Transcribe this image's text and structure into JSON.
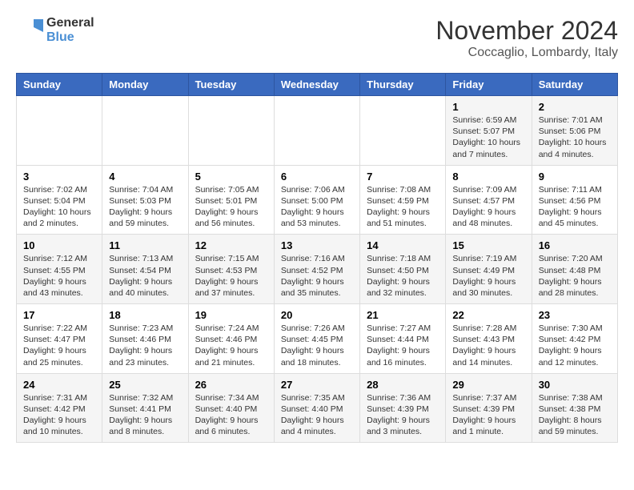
{
  "logo": {
    "line1": "General",
    "line2": "Blue"
  },
  "title": "November 2024",
  "location": "Coccaglio, Lombardy, Italy",
  "weekdays": [
    "Sunday",
    "Monday",
    "Tuesday",
    "Wednesday",
    "Thursday",
    "Friday",
    "Saturday"
  ],
  "weeks": [
    [
      {
        "day": "",
        "info": ""
      },
      {
        "day": "",
        "info": ""
      },
      {
        "day": "",
        "info": ""
      },
      {
        "day": "",
        "info": ""
      },
      {
        "day": "",
        "info": ""
      },
      {
        "day": "1",
        "info": "Sunrise: 6:59 AM\nSunset: 5:07 PM\nDaylight: 10 hours and 7 minutes."
      },
      {
        "day": "2",
        "info": "Sunrise: 7:01 AM\nSunset: 5:06 PM\nDaylight: 10 hours and 4 minutes."
      }
    ],
    [
      {
        "day": "3",
        "info": "Sunrise: 7:02 AM\nSunset: 5:04 PM\nDaylight: 10 hours and 2 minutes."
      },
      {
        "day": "4",
        "info": "Sunrise: 7:04 AM\nSunset: 5:03 PM\nDaylight: 9 hours and 59 minutes."
      },
      {
        "day": "5",
        "info": "Sunrise: 7:05 AM\nSunset: 5:01 PM\nDaylight: 9 hours and 56 minutes."
      },
      {
        "day": "6",
        "info": "Sunrise: 7:06 AM\nSunset: 5:00 PM\nDaylight: 9 hours and 53 minutes."
      },
      {
        "day": "7",
        "info": "Sunrise: 7:08 AM\nSunset: 4:59 PM\nDaylight: 9 hours and 51 minutes."
      },
      {
        "day": "8",
        "info": "Sunrise: 7:09 AM\nSunset: 4:57 PM\nDaylight: 9 hours and 48 minutes."
      },
      {
        "day": "9",
        "info": "Sunrise: 7:11 AM\nSunset: 4:56 PM\nDaylight: 9 hours and 45 minutes."
      }
    ],
    [
      {
        "day": "10",
        "info": "Sunrise: 7:12 AM\nSunset: 4:55 PM\nDaylight: 9 hours and 43 minutes."
      },
      {
        "day": "11",
        "info": "Sunrise: 7:13 AM\nSunset: 4:54 PM\nDaylight: 9 hours and 40 minutes."
      },
      {
        "day": "12",
        "info": "Sunrise: 7:15 AM\nSunset: 4:53 PM\nDaylight: 9 hours and 37 minutes."
      },
      {
        "day": "13",
        "info": "Sunrise: 7:16 AM\nSunset: 4:52 PM\nDaylight: 9 hours and 35 minutes."
      },
      {
        "day": "14",
        "info": "Sunrise: 7:18 AM\nSunset: 4:50 PM\nDaylight: 9 hours and 32 minutes."
      },
      {
        "day": "15",
        "info": "Sunrise: 7:19 AM\nSunset: 4:49 PM\nDaylight: 9 hours and 30 minutes."
      },
      {
        "day": "16",
        "info": "Sunrise: 7:20 AM\nSunset: 4:48 PM\nDaylight: 9 hours and 28 minutes."
      }
    ],
    [
      {
        "day": "17",
        "info": "Sunrise: 7:22 AM\nSunset: 4:47 PM\nDaylight: 9 hours and 25 minutes."
      },
      {
        "day": "18",
        "info": "Sunrise: 7:23 AM\nSunset: 4:46 PM\nDaylight: 9 hours and 23 minutes."
      },
      {
        "day": "19",
        "info": "Sunrise: 7:24 AM\nSunset: 4:46 PM\nDaylight: 9 hours and 21 minutes."
      },
      {
        "day": "20",
        "info": "Sunrise: 7:26 AM\nSunset: 4:45 PM\nDaylight: 9 hours and 18 minutes."
      },
      {
        "day": "21",
        "info": "Sunrise: 7:27 AM\nSunset: 4:44 PM\nDaylight: 9 hours and 16 minutes."
      },
      {
        "day": "22",
        "info": "Sunrise: 7:28 AM\nSunset: 4:43 PM\nDaylight: 9 hours and 14 minutes."
      },
      {
        "day": "23",
        "info": "Sunrise: 7:30 AM\nSunset: 4:42 PM\nDaylight: 9 hours and 12 minutes."
      }
    ],
    [
      {
        "day": "24",
        "info": "Sunrise: 7:31 AM\nSunset: 4:42 PM\nDaylight: 9 hours and 10 minutes."
      },
      {
        "day": "25",
        "info": "Sunrise: 7:32 AM\nSunset: 4:41 PM\nDaylight: 9 hours and 8 minutes."
      },
      {
        "day": "26",
        "info": "Sunrise: 7:34 AM\nSunset: 4:40 PM\nDaylight: 9 hours and 6 minutes."
      },
      {
        "day": "27",
        "info": "Sunrise: 7:35 AM\nSunset: 4:40 PM\nDaylight: 9 hours and 4 minutes."
      },
      {
        "day": "28",
        "info": "Sunrise: 7:36 AM\nSunset: 4:39 PM\nDaylight: 9 hours and 3 minutes."
      },
      {
        "day": "29",
        "info": "Sunrise: 7:37 AM\nSunset: 4:39 PM\nDaylight: 9 hours and 1 minute."
      },
      {
        "day": "30",
        "info": "Sunrise: 7:38 AM\nSunset: 4:38 PM\nDaylight: 8 hours and 59 minutes."
      }
    ]
  ]
}
